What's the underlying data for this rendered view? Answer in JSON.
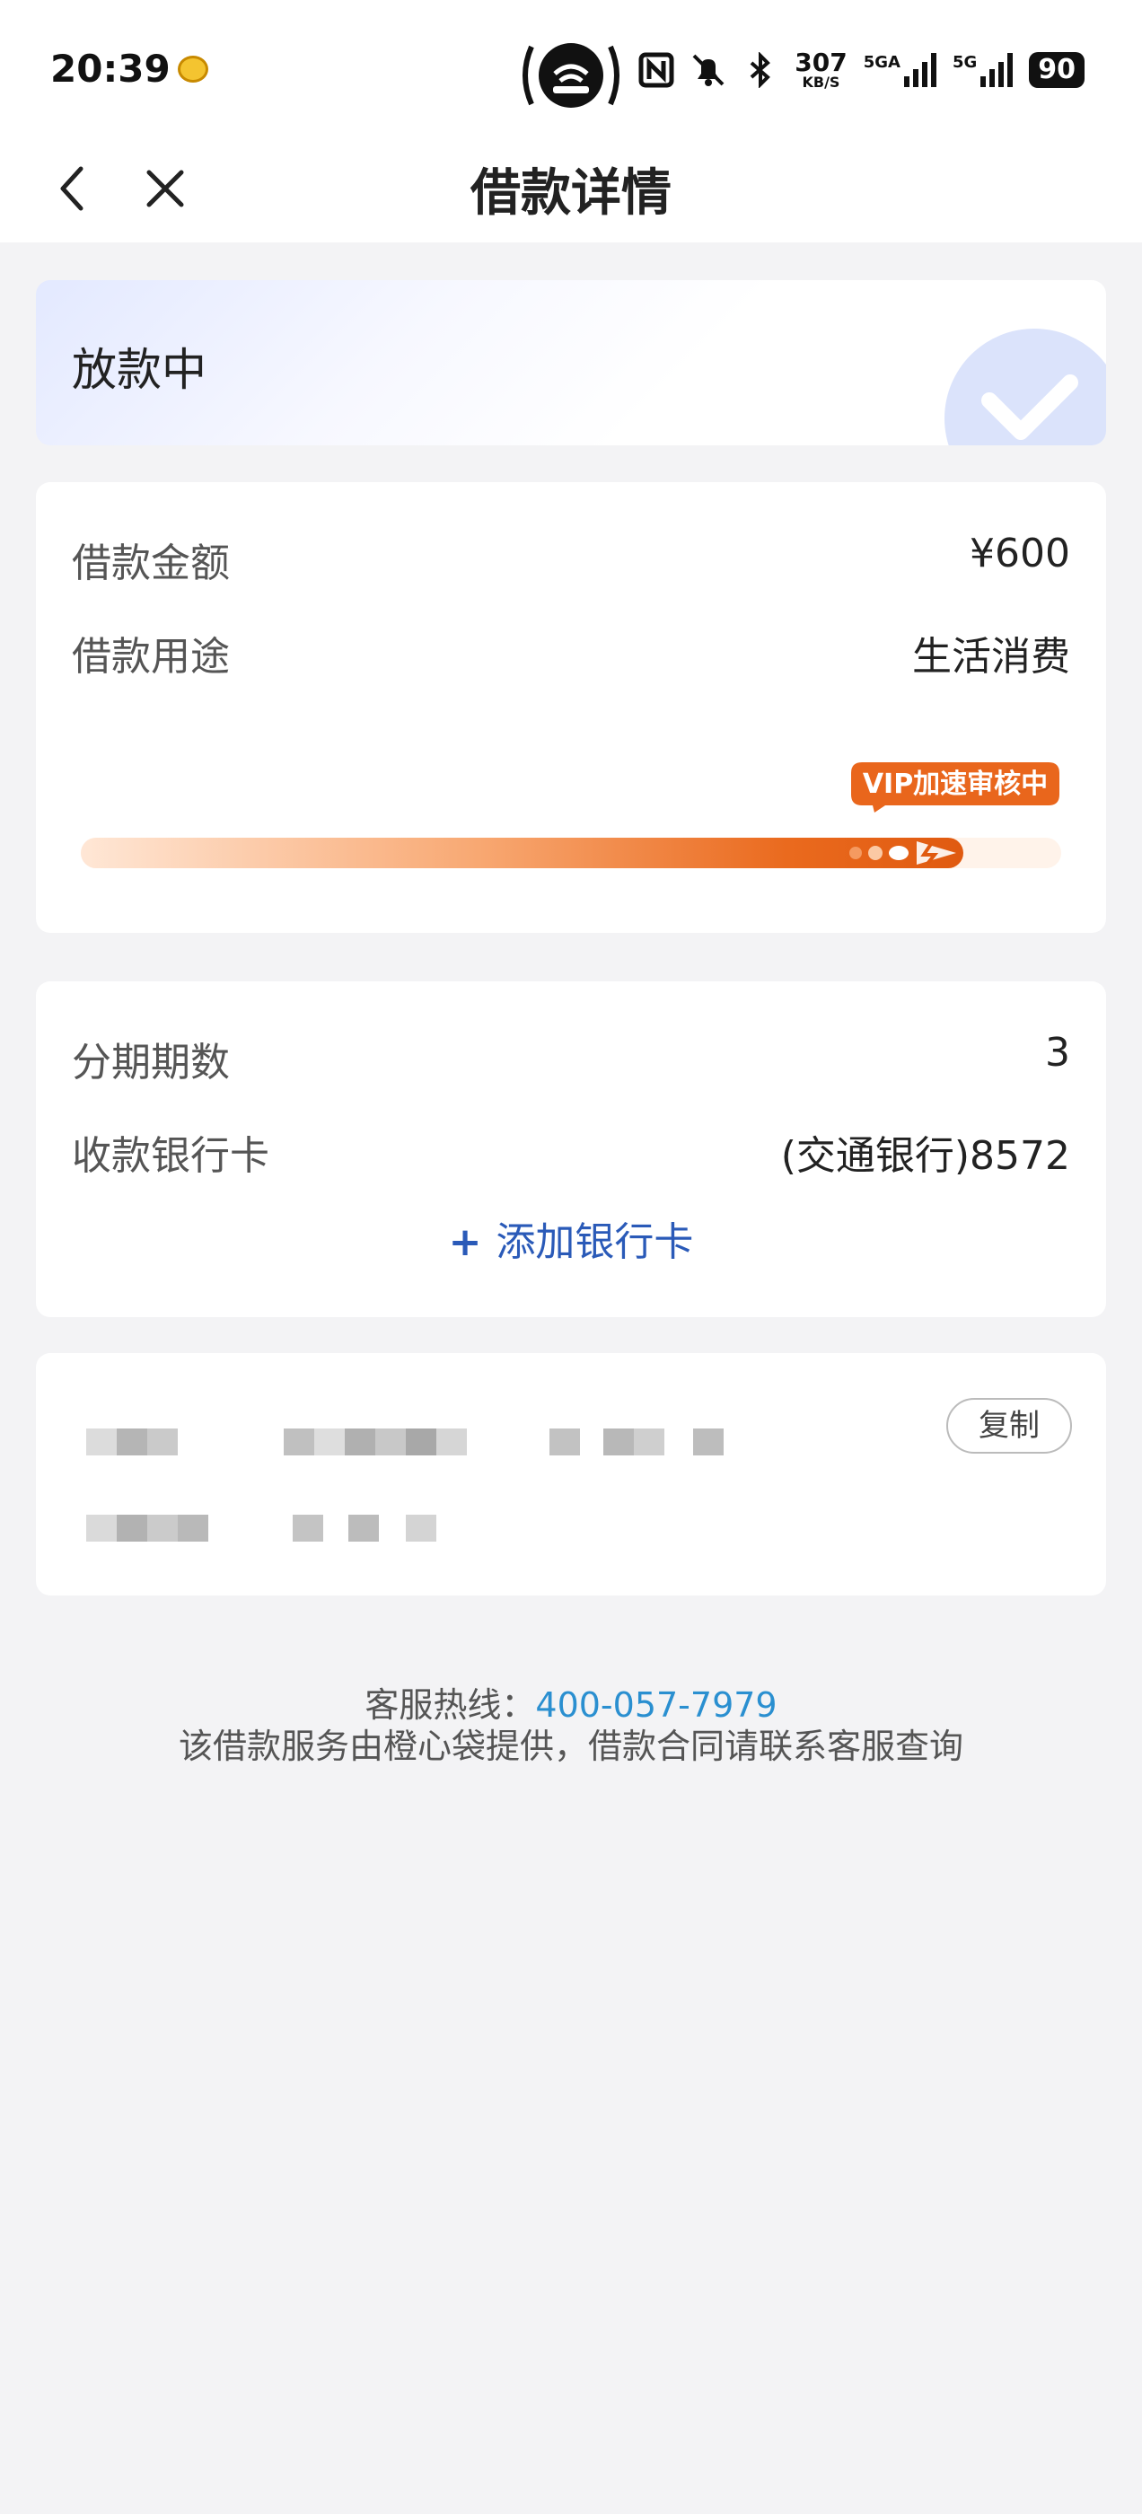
{
  "status_bar": {
    "time": "20:39",
    "speed_value": "307",
    "speed_unit": "KB/S",
    "net1_label": "5GA",
    "net2_label": "5G",
    "battery": "90"
  },
  "header": {
    "title": "借款详情"
  },
  "loan_status": {
    "text": "放款中"
  },
  "loan_info": {
    "amount_label": "借款金额",
    "amount_value": "¥600",
    "purpose_label": "借款用途",
    "purpose_value": "生活消费",
    "progress_badge": "VIP加速审核中",
    "progress_fraction": 0.9
  },
  "bank_info": {
    "installments_label": "分期期数",
    "installments_value": "3",
    "bank_card_label": "收款银行卡",
    "bank_card_value": "(交通银行)8572",
    "add_card_label": "添加银行卡"
  },
  "copy_card": {
    "copy_label": "复制"
  },
  "footer": {
    "hotline_label": "客服热线：",
    "hotline_number": "400-057-7979",
    "notice": "该借款服务由橙心袋提供，借款合同请联系客服查询"
  },
  "colors": {
    "accent_orange": "#e9661c",
    "link_blue": "#2a8fd0",
    "add_card_blue": "#2a5ab8"
  }
}
